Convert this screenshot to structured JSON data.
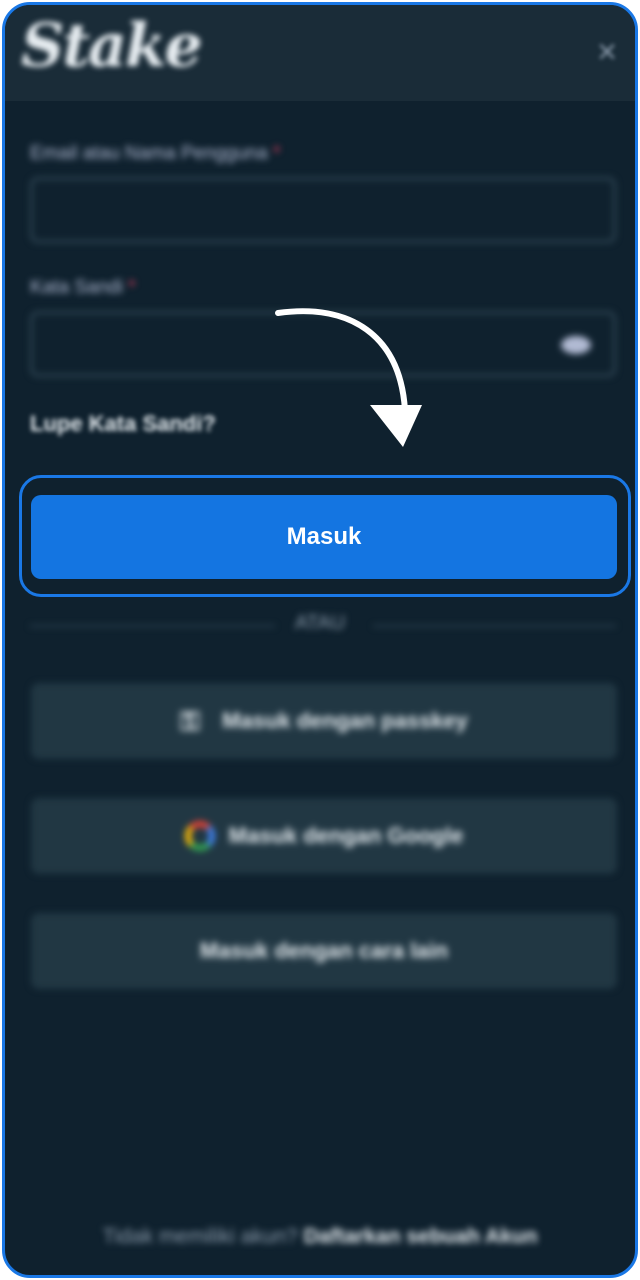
{
  "header": {
    "logo_text": "Stake",
    "close_icon": "×"
  },
  "form": {
    "email_label": "Email atau Nama Pengguna",
    "password_label": "Kata Sandi",
    "required_mark": "*",
    "email_value": "",
    "password_value": "",
    "forgot_label": "Lupe Kata Sandi?",
    "submit_label": "Masuk"
  },
  "divider_text": "ATAU",
  "alt_logins": [
    {
      "label": "Masuk dengan passkey",
      "icon": "passkey-icon"
    },
    {
      "label": "Masuk dengan Google",
      "icon": "google-icon"
    },
    {
      "label": "Masuk dengan cara lain",
      "icon": ""
    }
  ],
  "footer": {
    "prompt": "Tidak memiliki akun?",
    "link": "Daftarkan sebuah Akun"
  },
  "colors": {
    "accent": "#1475e1",
    "background": "#0f212e",
    "outline": "#1a78e6"
  }
}
